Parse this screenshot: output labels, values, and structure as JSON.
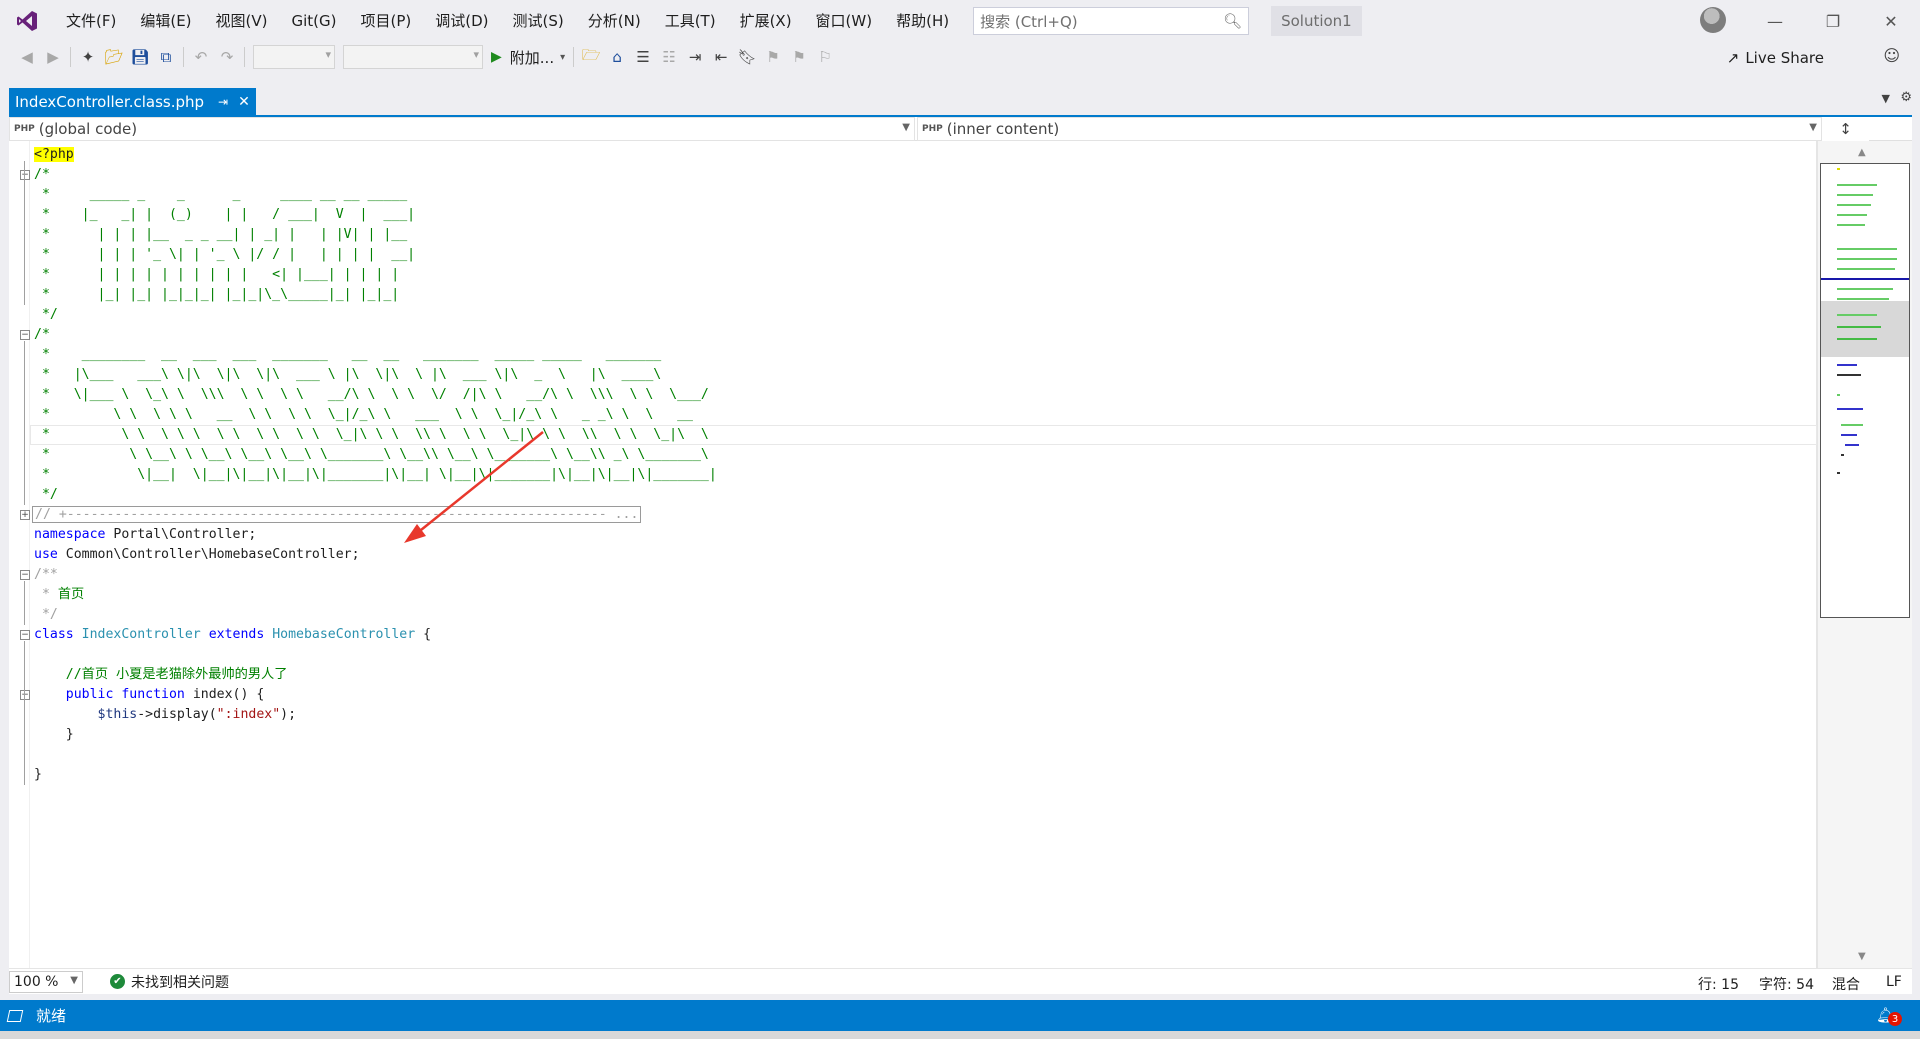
{
  "menu": {
    "items": [
      "文件(F)",
      "编辑(E)",
      "视图(V)",
      "Git(G)",
      "项目(P)",
      "调试(D)",
      "测试(S)",
      "分析(N)",
      "工具(T)",
      "扩展(X)",
      "窗口(W)",
      "帮助(H)"
    ],
    "search_placeholder": "搜索 (Ctrl+Q)",
    "solution_name": "Solution1"
  },
  "toolbar": {
    "attach_label": "附加...",
    "live_share_label": "Live Share"
  },
  "tab": {
    "title": "IndexController.class.php"
  },
  "navbar": {
    "left_badge": "PHP",
    "left_scope": "(global code)",
    "right_badge": "PHP",
    "right_scope": "(inner content)"
  },
  "code": {
    "lines": [
      "<?php",
      "/*",
      " *     _____ _    _      _     ____ __ __ _____",
      " *    |_   _| |  (_)    | |   / ___|  V  |  ___|",
      " *      | | | |__  _ _ __| | _| |   | |V| | |__",
      " *      | | | '_ \\| | '_ \\ |/ / |   | | | |  __|",
      " *      | | | | | | | | | |   <| |___| | | | |",
      " *      |_| |_| |_|_|_| |_|_|\\_\\_____|_| |_|_|",
      " */",
      "/*",
      " *    ________  __  ___  ___  _______   __  __   _______  _____ _____   _______",
      " *   |\\___   ___\\ \\|\\  \\|\\  \\|\\  ___ \\ |\\  \\|\\  \\ |\\  ___ \\|\\  _  \\   |\\  ____\\",
      " *   \\|___ \\  \\_\\ \\  \\\\\\  \\ \\  \\ \\   __/\\ \\  \\ \\  \\/  /|\\ \\   __/\\ \\  \\\\\\  \\ \\  \\___/",
      " *        \\ \\  \\ \\ \\   __  \\ \\  \\ \\  \\_|/_\\ \\   ___  \\ \\  \\_|/_\\ \\   _ _\\ \\  \\   __",
      " *         \\ \\  \\ \\ \\  \\ \\  \\ \\  \\ \\  \\_|\\ \\ \\  \\\\ \\  \\ \\  \\_|\\ \\ \\  \\\\  \\ \\  \\_|\\  \\",
      " *          \\ \\__\\ \\ \\__\\ \\__\\ \\__\\ \\_______\\ \\__\\\\ \\__\\ \\_______\\ \\__\\\\ _\\ \\_______\\",
      " *           \\|__|  \\|__|\\|__|\\|__|\\|_______|\\|__| \\|__|\\|_______|\\|__|\\|__|\\|_______|",
      " */",
      "// +-------------------------------------------------------------------- ...",
      "namespace Portal\\Controller;",
      "use Common\\Controller\\HomebaseController;",
      "/**",
      " * 首页",
      " */",
      "class IndexController extends HomebaseController {",
      "",
      "    //首页 小夏是老猫除外最帅的男人了",
      "    public function index() {",
      "        $this->display(\":index\");",
      "    }",
      "",
      "}"
    ]
  },
  "editor_status": {
    "zoom": "100 %",
    "issues": "未找到相关问题",
    "line": "行: 15",
    "char": "字符: 54",
    "tabs": "混合",
    "eol": "LF"
  },
  "statusbar": {
    "ready": "就绪",
    "notifications": "3"
  },
  "colors": {
    "accent": "#007acc",
    "annotation_arrow": "#e8382c"
  }
}
